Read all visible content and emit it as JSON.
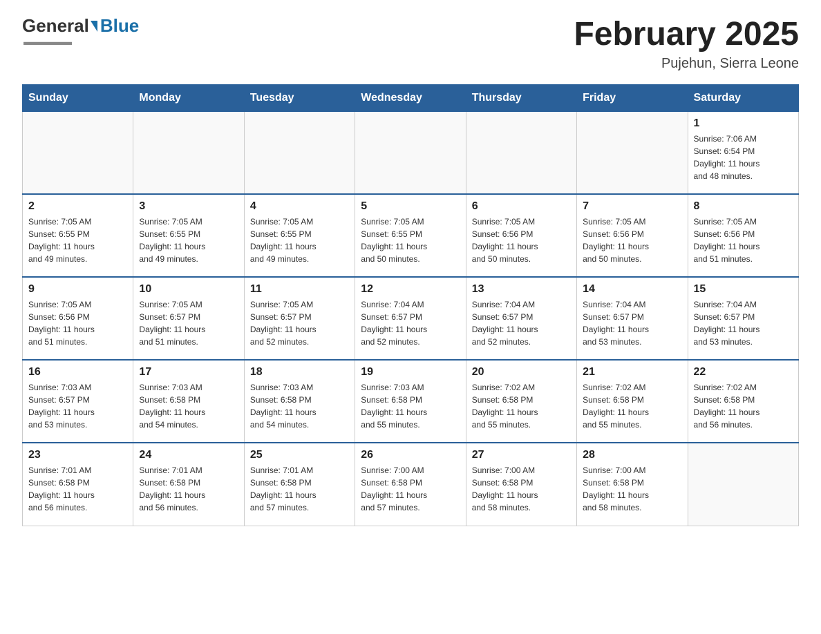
{
  "header": {
    "logo_general": "General",
    "logo_blue": "Blue",
    "title": "February 2025",
    "subtitle": "Pujehun, Sierra Leone"
  },
  "days_of_week": [
    "Sunday",
    "Monday",
    "Tuesday",
    "Wednesday",
    "Thursday",
    "Friday",
    "Saturday"
  ],
  "weeks": [
    {
      "days": [
        {
          "number": "",
          "info": ""
        },
        {
          "number": "",
          "info": ""
        },
        {
          "number": "",
          "info": ""
        },
        {
          "number": "",
          "info": ""
        },
        {
          "number": "",
          "info": ""
        },
        {
          "number": "",
          "info": ""
        },
        {
          "number": "1",
          "info": "Sunrise: 7:06 AM\nSunset: 6:54 PM\nDaylight: 11 hours\nand 48 minutes."
        }
      ]
    },
    {
      "days": [
        {
          "number": "2",
          "info": "Sunrise: 7:05 AM\nSunset: 6:55 PM\nDaylight: 11 hours\nand 49 minutes."
        },
        {
          "number": "3",
          "info": "Sunrise: 7:05 AM\nSunset: 6:55 PM\nDaylight: 11 hours\nand 49 minutes."
        },
        {
          "number": "4",
          "info": "Sunrise: 7:05 AM\nSunset: 6:55 PM\nDaylight: 11 hours\nand 49 minutes."
        },
        {
          "number": "5",
          "info": "Sunrise: 7:05 AM\nSunset: 6:55 PM\nDaylight: 11 hours\nand 50 minutes."
        },
        {
          "number": "6",
          "info": "Sunrise: 7:05 AM\nSunset: 6:56 PM\nDaylight: 11 hours\nand 50 minutes."
        },
        {
          "number": "7",
          "info": "Sunrise: 7:05 AM\nSunset: 6:56 PM\nDaylight: 11 hours\nand 50 minutes."
        },
        {
          "number": "8",
          "info": "Sunrise: 7:05 AM\nSunset: 6:56 PM\nDaylight: 11 hours\nand 51 minutes."
        }
      ]
    },
    {
      "days": [
        {
          "number": "9",
          "info": "Sunrise: 7:05 AM\nSunset: 6:56 PM\nDaylight: 11 hours\nand 51 minutes."
        },
        {
          "number": "10",
          "info": "Sunrise: 7:05 AM\nSunset: 6:57 PM\nDaylight: 11 hours\nand 51 minutes."
        },
        {
          "number": "11",
          "info": "Sunrise: 7:05 AM\nSunset: 6:57 PM\nDaylight: 11 hours\nand 52 minutes."
        },
        {
          "number": "12",
          "info": "Sunrise: 7:04 AM\nSunset: 6:57 PM\nDaylight: 11 hours\nand 52 minutes."
        },
        {
          "number": "13",
          "info": "Sunrise: 7:04 AM\nSunset: 6:57 PM\nDaylight: 11 hours\nand 52 minutes."
        },
        {
          "number": "14",
          "info": "Sunrise: 7:04 AM\nSunset: 6:57 PM\nDaylight: 11 hours\nand 53 minutes."
        },
        {
          "number": "15",
          "info": "Sunrise: 7:04 AM\nSunset: 6:57 PM\nDaylight: 11 hours\nand 53 minutes."
        }
      ]
    },
    {
      "days": [
        {
          "number": "16",
          "info": "Sunrise: 7:03 AM\nSunset: 6:57 PM\nDaylight: 11 hours\nand 53 minutes."
        },
        {
          "number": "17",
          "info": "Sunrise: 7:03 AM\nSunset: 6:58 PM\nDaylight: 11 hours\nand 54 minutes."
        },
        {
          "number": "18",
          "info": "Sunrise: 7:03 AM\nSunset: 6:58 PM\nDaylight: 11 hours\nand 54 minutes."
        },
        {
          "number": "19",
          "info": "Sunrise: 7:03 AM\nSunset: 6:58 PM\nDaylight: 11 hours\nand 55 minutes."
        },
        {
          "number": "20",
          "info": "Sunrise: 7:02 AM\nSunset: 6:58 PM\nDaylight: 11 hours\nand 55 minutes."
        },
        {
          "number": "21",
          "info": "Sunrise: 7:02 AM\nSunset: 6:58 PM\nDaylight: 11 hours\nand 55 minutes."
        },
        {
          "number": "22",
          "info": "Sunrise: 7:02 AM\nSunset: 6:58 PM\nDaylight: 11 hours\nand 56 minutes."
        }
      ]
    },
    {
      "days": [
        {
          "number": "23",
          "info": "Sunrise: 7:01 AM\nSunset: 6:58 PM\nDaylight: 11 hours\nand 56 minutes."
        },
        {
          "number": "24",
          "info": "Sunrise: 7:01 AM\nSunset: 6:58 PM\nDaylight: 11 hours\nand 56 minutes."
        },
        {
          "number": "25",
          "info": "Sunrise: 7:01 AM\nSunset: 6:58 PM\nDaylight: 11 hours\nand 57 minutes."
        },
        {
          "number": "26",
          "info": "Sunrise: 7:00 AM\nSunset: 6:58 PM\nDaylight: 11 hours\nand 57 minutes."
        },
        {
          "number": "27",
          "info": "Sunrise: 7:00 AM\nSunset: 6:58 PM\nDaylight: 11 hours\nand 58 minutes."
        },
        {
          "number": "28",
          "info": "Sunrise: 7:00 AM\nSunset: 6:58 PM\nDaylight: 11 hours\nand 58 minutes."
        },
        {
          "number": "",
          "info": ""
        }
      ]
    }
  ]
}
